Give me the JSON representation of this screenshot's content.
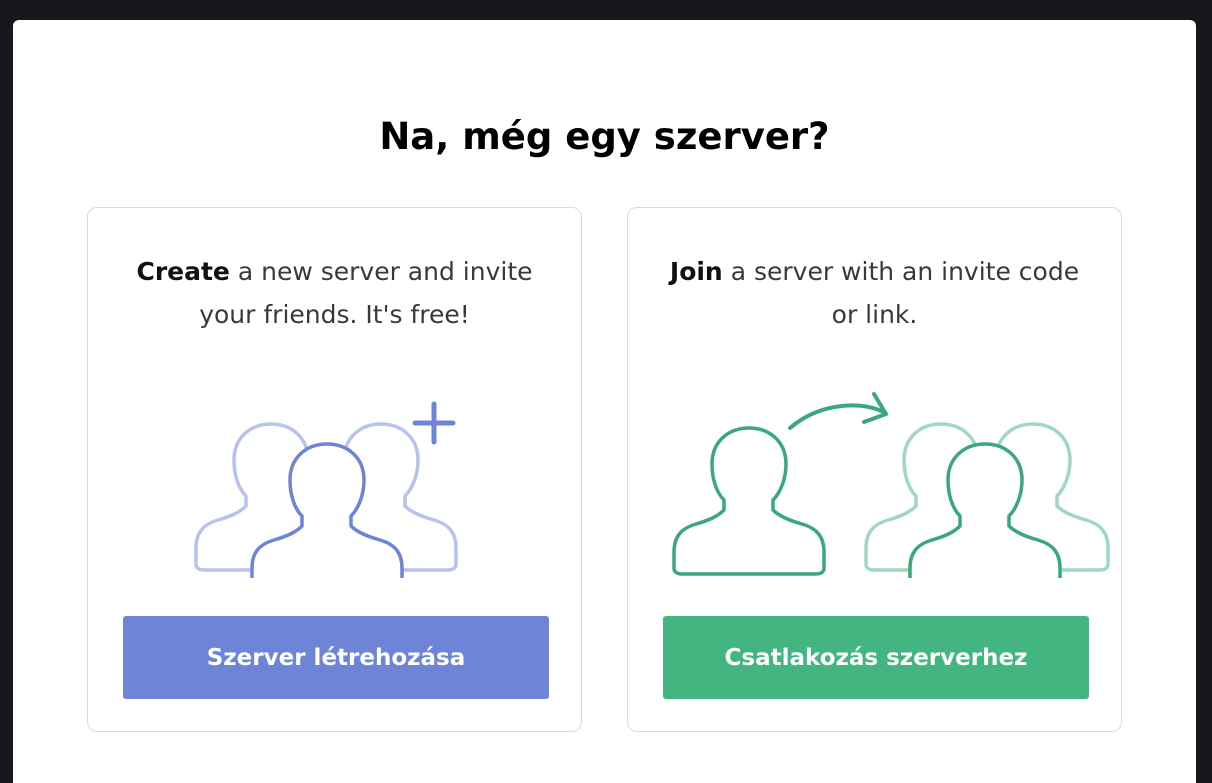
{
  "modal": {
    "title": "Na, még egy szerver?"
  },
  "create_card": {
    "bold_text": "Create",
    "text_rest": " a new server and invite your friends. It's free!",
    "button_label": "Szerver létrehozása",
    "accent_color": "#6e84d6",
    "illustration_icon": "add-people-icon"
  },
  "join_card": {
    "bold_text": "Join",
    "text_rest": " a server with an invite code or link.",
    "button_label": "Csatlakozás szerverhez",
    "accent_color": "#43b581",
    "illustration_icon": "join-people-icon"
  }
}
